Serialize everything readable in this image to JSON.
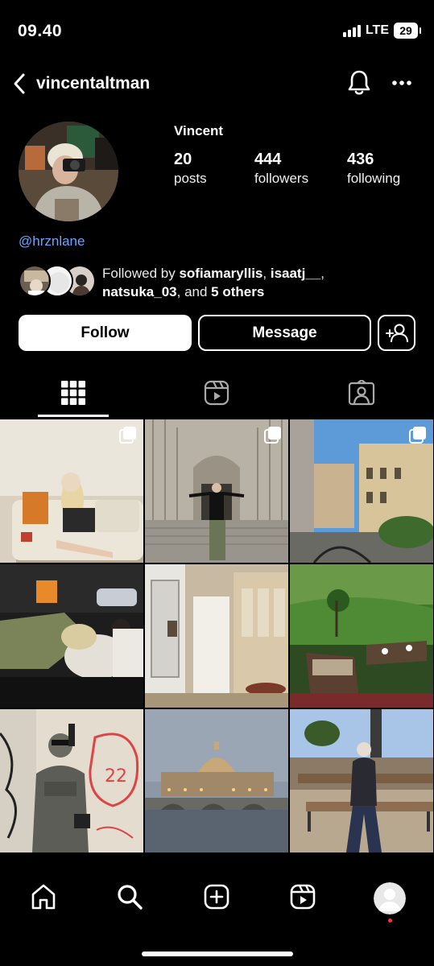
{
  "status_bar": {
    "time": "09.40",
    "network": "LTE",
    "battery": "29"
  },
  "header": {
    "username": "vincentaltman"
  },
  "profile": {
    "display_name": "Vincent",
    "stats": [
      {
        "value": "20",
        "label": "posts"
      },
      {
        "value": "444",
        "label": "followers"
      },
      {
        "value": "436",
        "label": "following"
      }
    ],
    "link": "@hrznlane"
  },
  "followed_by": {
    "prefix": "Followed by ",
    "names": [
      "sofiamaryllis",
      "isaatj__",
      "natsuka_03"
    ],
    "sep": ", ",
    "and": ", and ",
    "others": "5 others"
  },
  "actions": {
    "follow_label": "Follow",
    "message_label": "Message"
  },
  "tabs": [
    {
      "name": "grid-icon",
      "active": true
    },
    {
      "name": "reels-icon",
      "active": false
    },
    {
      "name": "tagged-icon",
      "active": false
    }
  ],
  "posts": [
    {
      "name": "post-1",
      "multi": true
    },
    {
      "name": "post-2",
      "multi": true
    },
    {
      "name": "post-3",
      "multi": true
    },
    {
      "name": "post-4",
      "multi": false
    },
    {
      "name": "post-5",
      "multi": false
    },
    {
      "name": "post-6",
      "multi": false
    },
    {
      "name": "post-7",
      "multi": false
    },
    {
      "name": "post-8",
      "multi": false
    },
    {
      "name": "post-9",
      "multi": false
    }
  ],
  "bottom_nav": [
    "home-icon",
    "search-icon",
    "create-icon",
    "reels-icon",
    "profile-avatar"
  ],
  "colors": {
    "background": "#000000",
    "link": "#6ea4ff",
    "notification_dot": "#ff3040"
  }
}
